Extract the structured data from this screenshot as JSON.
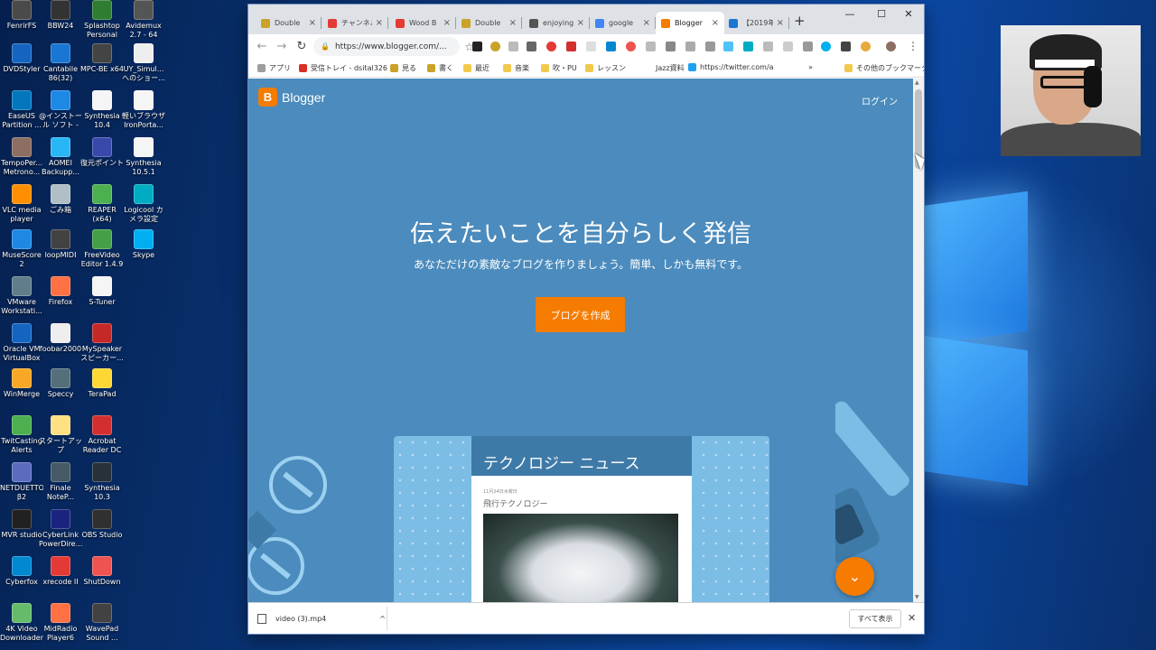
{
  "desktop": {
    "icons": [
      {
        "label": "FenrirFS",
        "color": "#4a4a4a"
      },
      {
        "label": "BBW24",
        "color": "#333"
      },
      {
        "label": "Splashtop Personal",
        "color": "#2e7d32"
      },
      {
        "label": "Avidemux 2.7 - 64 bits",
        "color": "#555"
      },
      {
        "label": "DVDStyler",
        "color": "#1565c0"
      },
      {
        "label": "Cantabile 86(32)",
        "color": "#1976d2"
      },
      {
        "label": "MPC-BE x64",
        "color": "#444"
      },
      {
        "label": "UY_Simul... へのショー...",
        "color": "#eee"
      },
      {
        "label": "EaseUS Partition ...",
        "color": "#0277bd"
      },
      {
        "label": "@インストール ソフト - ショ...",
        "color": "#1e88e5"
      },
      {
        "label": "Synthesia 10.4",
        "color": "#f5f5f5"
      },
      {
        "label": "軽いブラウザ IronPorta...",
        "color": "#f5f5f5"
      },
      {
        "label": "TempoPer... Metrono...",
        "color": "#8d6e63"
      },
      {
        "label": "AOMEI Backupp...",
        "color": "#29b6f6"
      },
      {
        "label": "復元ポイント",
        "color": "#3949ab"
      },
      {
        "label": "Synthesia 10.5.1",
        "color": "#f5f5f5"
      },
      {
        "label": "VLC media player",
        "color": "#ff8f00"
      },
      {
        "label": "ごみ箱",
        "color": "#b0bec5"
      },
      {
        "label": "REAPER (x64)",
        "color": "#4caf50"
      },
      {
        "label": "Logicool カメラ設定",
        "color": "#00acc1"
      },
      {
        "label": "MuseScore 2",
        "color": "#1e88e5"
      },
      {
        "label": "loopMIDI",
        "color": "#424242"
      },
      {
        "label": "FreeVideo Editor 1.4.9",
        "color": "#43a047"
      },
      {
        "label": "Skype",
        "color": "#00aff0"
      },
      {
        "label": "VMware Workstati...",
        "color": "#607d8b"
      },
      {
        "label": "Firefox",
        "color": "#ff7043"
      },
      {
        "label": "S-Tuner",
        "color": "#f5f5f5"
      },
      {
        "label": "Oracle VM VirtualBox",
        "color": "#1565c0"
      },
      {
        "label": "foobar2000",
        "color": "#eee"
      },
      {
        "label": "MySpeaker スピーカー...",
        "color": "#c62828"
      },
      {
        "label": "WinMerge",
        "color": "#f9a825"
      },
      {
        "label": "Speccy",
        "color": "#546e7a"
      },
      {
        "label": "TeraPad",
        "color": "#fdd835"
      },
      {
        "label": "TwitCasting Alerts",
        "color": "#4caf50"
      },
      {
        "label": "スタートアップ",
        "color": "#ffe082"
      },
      {
        "label": "Acrobat Reader DC",
        "color": "#d32f2f"
      },
      {
        "label": "NETDUETTO β2",
        "color": "#5c6bc0"
      },
      {
        "label": "Finale NoteP...",
        "color": "#455a64"
      },
      {
        "label": "Synthesia 10.3",
        "color": "#263238"
      },
      {
        "label": "MVR studio",
        "color": "#212121"
      },
      {
        "label": "CyberLink PowerDire...",
        "color": "#1a237e"
      },
      {
        "label": "OBS Studio",
        "color": "#303030"
      },
      {
        "label": "Cyberfox",
        "color": "#0288d1"
      },
      {
        "label": "xrecode II",
        "color": "#e53935"
      },
      {
        "label": "ShutDown",
        "color": "#ef5350"
      },
      {
        "label": "4K Video Downloader",
        "color": "#66bb6a"
      },
      {
        "label": "MidRadio Player6",
        "color": "#ff7043"
      },
      {
        "label": "WavePad Sound ...",
        "color": "#424242"
      }
    ]
  },
  "browser": {
    "tabs": [
      {
        "title": "Double",
        "fav": "#c9a227"
      },
      {
        "title": "チャンネル",
        "fav": "#e53935"
      },
      {
        "title": "Wood B",
        "fav": "#e53935"
      },
      {
        "title": "Double",
        "fav": "#c9a227"
      },
      {
        "title": "enjoying",
        "fav": "#555"
      },
      {
        "title": "google",
        "fav": "#4285f4"
      },
      {
        "title": "Blogger",
        "fav": "#f57c00"
      },
      {
        "title": "【2019年",
        "fav": "#1976d2"
      }
    ],
    "close_glyph": "×",
    "new_tab": "+",
    "window_controls": {
      "minimize": "—",
      "maximize": "☐",
      "close": "✕"
    },
    "url": "https://www.blogger.com/...",
    "bookmarks": [
      {
        "label": "アプリ",
        "color": "#9e9e9e"
      },
      {
        "label": "受信トレイ - dsital326",
        "color": "#d93025"
      },
      {
        "label": "見る",
        "color": "#c9a227"
      },
      {
        "label": "書く",
        "color": "#c9a227"
      },
      {
        "label": "最近",
        "color": "#f2c94c"
      },
      {
        "label": "音楽",
        "color": "#f2c94c"
      },
      {
        "label": "吹・PU",
        "color": "#f2c94c"
      },
      {
        "label": "レッスン",
        "color": "#f2c94c"
      },
      {
        "label": "Jazz資料",
        "color": "#ffffff"
      },
      {
        "label": "https://twitter.com/a",
        "color": "#1da1f2"
      },
      {
        "label": "その他のブックマーク",
        "color": "#f2c94c"
      }
    ],
    "more_bookmarks": "»"
  },
  "page": {
    "brand": "Blogger",
    "brand_letter": "B",
    "login": "ログイン",
    "hero_title": "伝えたいことを自分らしく発信",
    "hero_subtitle": "あなただけの素敵なブログを作りましょう。簡単、しかも無料です。",
    "cta": "ブログを作成",
    "card": {
      "title": "テクノロジー ニュース",
      "date": "11月24日水曜日",
      "post_title": "飛行テクノロジー"
    },
    "fab_icon": "chevron-down-icon"
  },
  "downloads": {
    "file": "video (3).mp4",
    "show_all": "すべて表示",
    "close": "✕"
  }
}
